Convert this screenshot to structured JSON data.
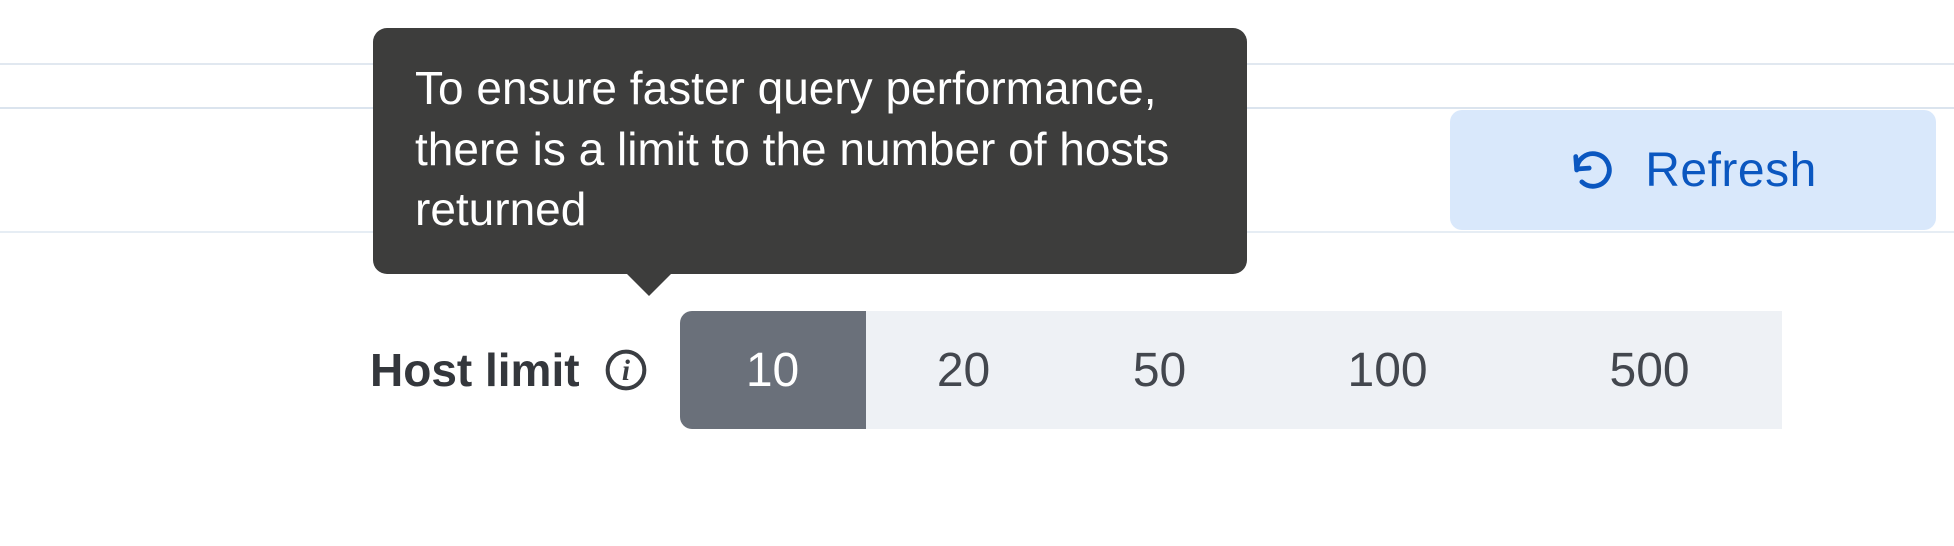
{
  "refresh": {
    "label": "Refresh"
  },
  "host_limit": {
    "label": "Host limit",
    "tooltip": "To ensure faster query performance, there is a limit to the number of hosts returned",
    "options": [
      "10",
      "20",
      "50",
      "100",
      "500"
    ],
    "selected": "10"
  },
  "colors": {
    "accent": "#0b57c0",
    "tooltip_bg": "#3d3d3c",
    "segment_bg": "#eef1f5",
    "segment_selected_bg": "#6a707a"
  }
}
